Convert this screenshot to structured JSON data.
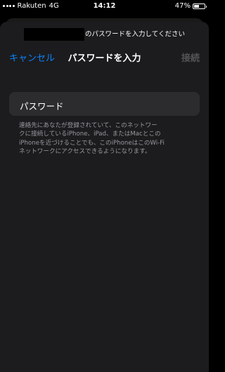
{
  "status_bar": {
    "carrier": "Rakuten",
    "network": "4G",
    "time": "14:12",
    "battery_text": "47%",
    "battery_level": 0.47
  },
  "prompt": {
    "ssid_redacted": true,
    "suffix": "のパスワードを入力してください"
  },
  "nav": {
    "cancel_label": "キャンセル",
    "title": "パスワードを入力",
    "join_label": "接続"
  },
  "password": {
    "label": "パスワード",
    "value": ""
  },
  "footer": {
    "lines": [
      "連絡先にあなたが登録されていて、このネットワー",
      "クに接続しているiPhone、iPad、またはMacとこの",
      "iPhoneを近づけることでも、このiPhoneはこのWi-Fi",
      "ネットワークにアクセスできるようになります。"
    ]
  },
  "colors": {
    "accent": "#0a84ff",
    "sheet": "#1c1c1e",
    "cell": "#2c2c2e",
    "disabled": "#545458",
    "secondary_text": "#98989f"
  }
}
